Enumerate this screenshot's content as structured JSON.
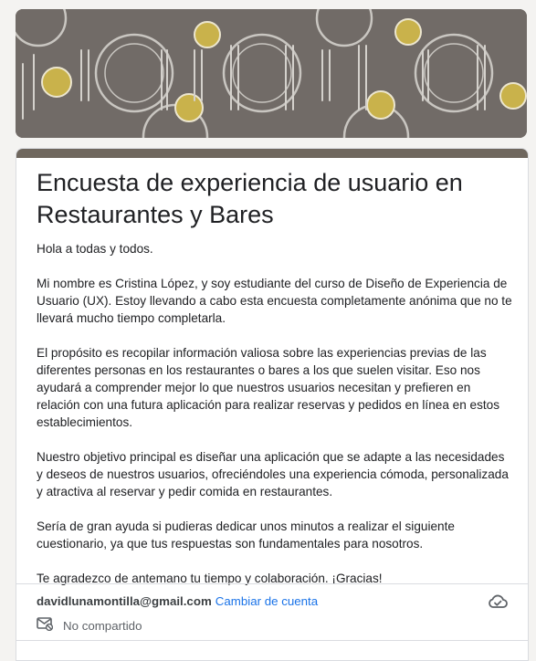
{
  "form": {
    "title": "Encuesta de experiencia de usuario en Restaurantes y Bares",
    "description": [
      "Hola a todas y todos.",
      "Mi nombre es Cristina López, y soy estudiante del curso de Diseño de Experiencia de Usuario (UX). Estoy llevando a cabo esta encuesta completamente anónima que no te llevará mucho tiempo completarla.",
      "El propósito es recopilar información valiosa sobre las experiencias previas de las diferentes personas en los restaurantes o bares a los que suelen visitar. Eso nos ayudará a comprender mejor lo que nuestros usuarios necesitan y prefieren en relación con una futura aplicación para realizar reservas y pedidos en línea en estos establecimientos.",
      "Nuestro objetivo principal es diseñar una aplicación que se adapte a las necesidades y deseos de nuestros usuarios, ofreciéndoles una experiencia cómoda, personalizada y atractiva al reservar y pedir comida en restaurantes.",
      "Sería de gran ayuda si pudieras dedicar unos minutos a realizar el siguiente cuestionario, ya que tus respuestas son fundamentales para nosotros.",
      "Te agradezco de antemano tu tiempo y colaboración. ¡Gracias!"
    ]
  },
  "account": {
    "email": "davidlunamontilla@gmail.com",
    "switch_label": "Cambiar de cuenta",
    "sharing_status": "No compartido",
    "cloud_icon": "cloud-done-icon",
    "sharing_icon": "mail-off-icon"
  },
  "theme": {
    "accent": "#6f675e",
    "banner_bg": "#716b67",
    "link": "#1a73e8"
  },
  "banner": {
    "pattern": "tableware-pattern"
  }
}
